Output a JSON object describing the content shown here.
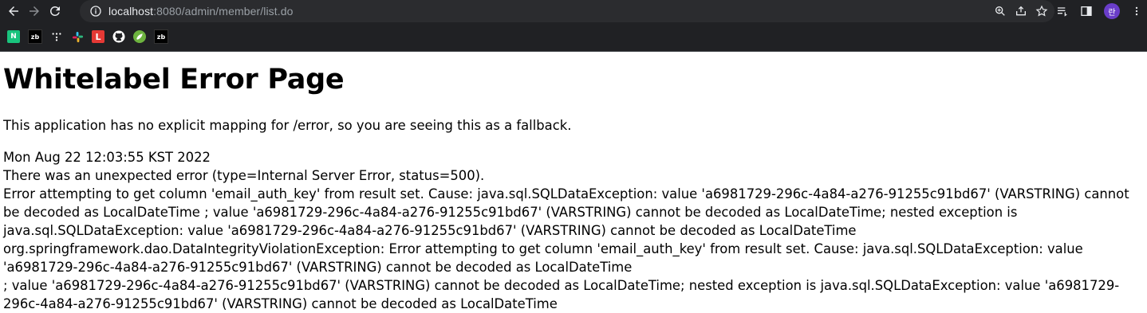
{
  "browser": {
    "url_host": "localhost",
    "url_rest": ":8080/admin/member/list.do",
    "profile_initial": "란",
    "bookmarks": [
      {
        "label": "N",
        "icon": "naver-icon"
      },
      {
        "label": "zb",
        "icon": "zb-icon"
      },
      {
        "label": "",
        "icon": "dots-icon"
      },
      {
        "label": "",
        "icon": "slack-icon"
      },
      {
        "label": "L",
        "icon": "l-icon"
      },
      {
        "label": "",
        "icon": "github-icon"
      },
      {
        "label": "",
        "icon": "spring-icon"
      },
      {
        "label": "zb",
        "icon": "zb-icon"
      }
    ]
  },
  "page": {
    "title": "Whitelabel Error Page",
    "lead": "This application has no explicit mapping for /error, so you are seeing this as a fallback.",
    "timestamp": "Mon Aug 22 12:03:55 KST 2022",
    "error_summary": "There was an unexpected error (type=Internal Server Error, status=500).",
    "error_message": "Error attempting to get column 'email_auth_key' from result set. Cause: java.sql.SQLDataException: value 'a6981729-296c-4a84-a276-91255c91bd67' (VARSTRING) cannot be decoded as LocalDateTime ; value 'a6981729-296c-4a84-a276-91255c91bd67' (VARSTRING) cannot be decoded as LocalDateTime; nested exception is java.sql.SQLDataException: value 'a6981729-296c-4a84-a276-91255c91bd67' (VARSTRING) cannot be decoded as LocalDateTime",
    "trace_line1": "org.springframework.dao.DataIntegrityViolationException: Error attempting to get column 'email_auth_key' from result set.  Cause: java.sql.SQLDataException: value 'a6981729-296c-4a84-a276-91255c91bd67' (VARSTRING) cannot be decoded as LocalDateTime",
    "trace_line2": "; value 'a6981729-296c-4a84-a276-91255c91bd67' (VARSTRING) cannot be decoded as LocalDateTime; nested exception is java.sql.SQLDataException: value 'a6981729-296c-4a84-a276-91255c91bd67' (VARSTRING) cannot be decoded as LocalDateTime"
  }
}
